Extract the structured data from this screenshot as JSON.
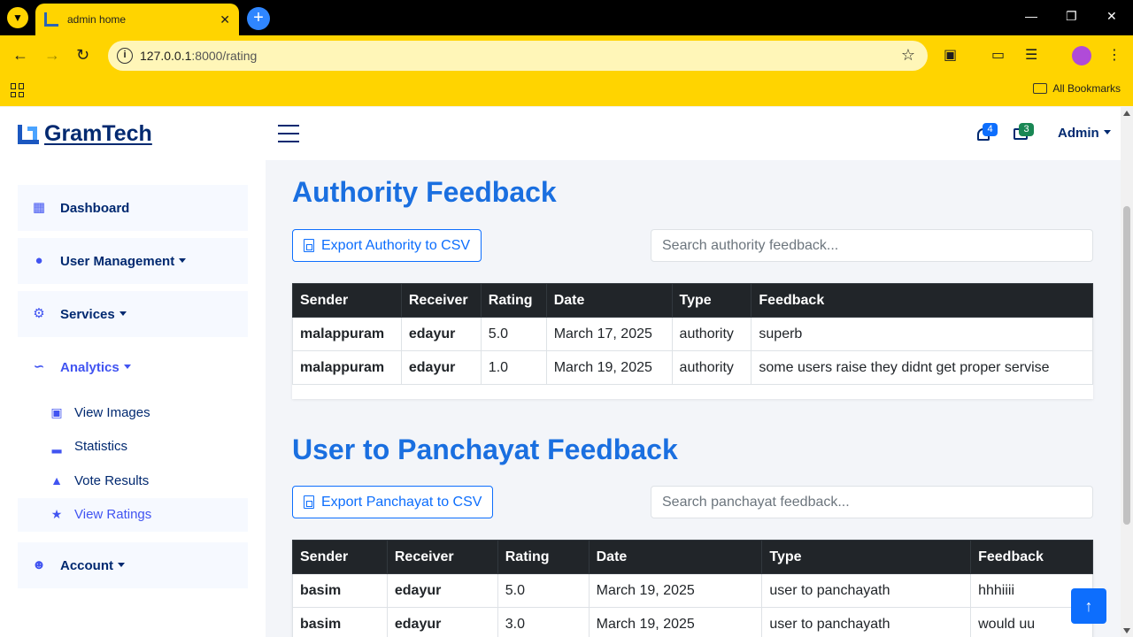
{
  "browser": {
    "tab_title": "admin home",
    "url_host": "127.0.0.1",
    "url_path": ":8000/rating",
    "all_bookmarks": "All Bookmarks"
  },
  "header": {
    "logo": "GramTech",
    "notifications_count": "4",
    "messages_count": "3",
    "admin_label": "Admin",
    "colors": {
      "brand": "#012970",
      "notif_badge": "#0d6efd",
      "msg_badge": "#198754"
    }
  },
  "sidebar": {
    "dashboard": "Dashboard",
    "user_management": "User Management",
    "services": "Services",
    "analytics": "Analytics",
    "analytics_items": [
      "View Images",
      "Statistics",
      "Vote Results",
      "View Ratings"
    ],
    "account": "Account"
  },
  "authority": {
    "title": "Authority Feedback",
    "export_label": "Export Authority to CSV",
    "search_placeholder": "Search authority feedback...",
    "headers": [
      "Sender",
      "Receiver",
      "Rating",
      "Date",
      "Type",
      "Feedback"
    ],
    "rows": [
      [
        "malappuram",
        "edayur",
        "5.0",
        "March 17, 2025",
        "authority",
        "superb"
      ],
      [
        "malappuram",
        "edayur",
        "1.0",
        "March 19, 2025",
        "authority",
        "some users raise they didnt get proper servise"
      ]
    ]
  },
  "panchayat": {
    "title": "User to Panchayat Feedback",
    "export_label": "Export Panchayat to CSV",
    "search_placeholder": "Search panchayat feedback...",
    "headers": [
      "Sender",
      "Receiver",
      "Rating",
      "Date",
      "Type",
      "Feedback"
    ],
    "rows": [
      [
        "basim",
        "edayur",
        "5.0",
        "March 19, 2025",
        "user to panchayath",
        "hhhiiii"
      ],
      [
        "basim",
        "edayur",
        "3.0",
        "March 19, 2025",
        "user to panchayath",
        "would uu"
      ]
    ]
  }
}
